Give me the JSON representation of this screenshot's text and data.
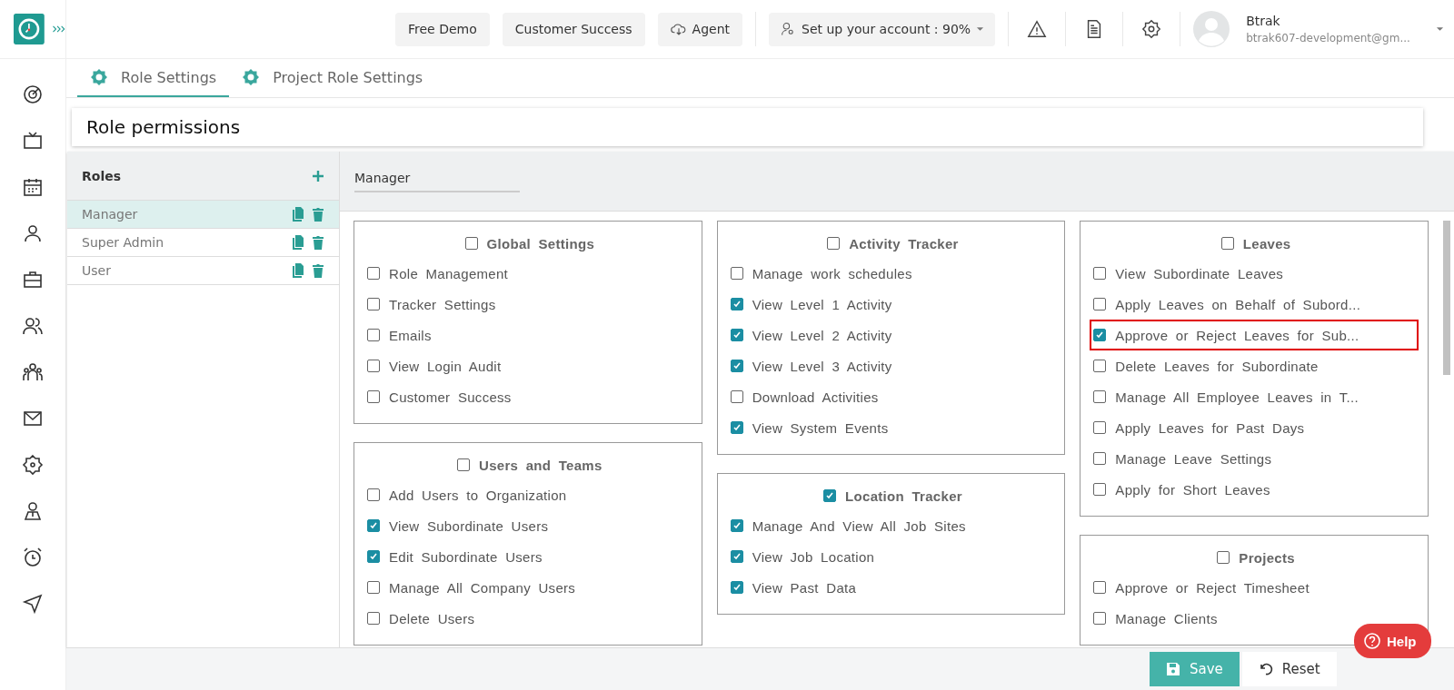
{
  "header": {
    "buttons": [
      {
        "label": "Free Demo",
        "kind": "text"
      },
      {
        "label": "Customer Success",
        "kind": "text"
      },
      {
        "label": "Agent",
        "kind": "cloud"
      }
    ],
    "account_setup": "Set up your account : 90%",
    "user": {
      "name": "Btrak",
      "email": "btrak607-development@gm..."
    }
  },
  "tabs": [
    {
      "label": "Role Settings",
      "selected": true
    },
    {
      "label": "Project Role Settings",
      "selected": false
    }
  ],
  "page_title": "Role permissions",
  "roles": {
    "title": "Roles",
    "items": [
      {
        "name": "Manager",
        "selected": true
      },
      {
        "name": "Super Admin",
        "selected": false
      },
      {
        "name": "User",
        "selected": false
      }
    ]
  },
  "role_name_field": {
    "value": "Manager"
  },
  "columns": [
    [
      {
        "title": "Global Settings",
        "checked": false,
        "permissions": [
          {
            "label": "Role Management",
            "checked": false,
            "highlighted": false
          },
          {
            "label": "Tracker Settings",
            "checked": false,
            "highlighted": false
          },
          {
            "label": "Emails",
            "checked": false,
            "highlighted": false
          },
          {
            "label": "View Login Audit",
            "checked": false,
            "highlighted": false
          },
          {
            "label": "Customer Success",
            "checked": false,
            "highlighted": false
          }
        ]
      },
      {
        "title": "Users and Teams",
        "checked": false,
        "permissions": [
          {
            "label": "Add Users to Organization",
            "checked": false,
            "highlighted": false
          },
          {
            "label": "View Subordinate Users",
            "checked": true,
            "highlighted": false
          },
          {
            "label": "Edit Subordinate Users",
            "checked": true,
            "highlighted": false
          },
          {
            "label": "Manage All Company Users",
            "checked": false,
            "highlighted": false
          },
          {
            "label": "Delete Users",
            "checked": false,
            "highlighted": false
          }
        ]
      }
    ],
    [
      {
        "title": "Activity Tracker",
        "checked": false,
        "permissions": [
          {
            "label": "Manage work schedules",
            "checked": false,
            "highlighted": false
          },
          {
            "label": "View Level 1 Activity",
            "checked": true,
            "highlighted": false
          },
          {
            "label": "View Level 2 Activity",
            "checked": true,
            "highlighted": false
          },
          {
            "label": "View Level 3 Activity",
            "checked": true,
            "highlighted": false
          },
          {
            "label": "Download Activities",
            "checked": false,
            "highlighted": false
          },
          {
            "label": "View System Events",
            "checked": true,
            "highlighted": false
          }
        ]
      },
      {
        "title": "Location Tracker",
        "checked": true,
        "permissions": [
          {
            "label": "Manage And View All Job Sites",
            "checked": true,
            "highlighted": false
          },
          {
            "label": "View Job Location",
            "checked": true,
            "highlighted": false
          },
          {
            "label": "View Past Data",
            "checked": true,
            "highlighted": false
          }
        ]
      }
    ],
    [
      {
        "title": "Leaves",
        "checked": false,
        "permissions": [
          {
            "label": "View Subordinate Leaves",
            "checked": false,
            "highlighted": false
          },
          {
            "label": "Apply Leaves on Behalf of Subord...",
            "checked": false,
            "highlighted": false
          },
          {
            "label": "Approve or Reject Leaves for Sub...",
            "checked": true,
            "highlighted": true
          },
          {
            "label": "Delete Leaves for Subordinate",
            "checked": false,
            "highlighted": false
          },
          {
            "label": "Manage All Employee Leaves in T...",
            "checked": false,
            "highlighted": false
          },
          {
            "label": "Apply Leaves for Past Days",
            "checked": false,
            "highlighted": false
          },
          {
            "label": "Manage Leave Settings",
            "checked": false,
            "highlighted": false
          },
          {
            "label": "Apply for Short Leaves",
            "checked": false,
            "highlighted": false
          }
        ]
      },
      {
        "title": "Projects",
        "checked": false,
        "permissions": [
          {
            "label": "Approve or Reject Timesheet",
            "checked": false,
            "highlighted": false
          },
          {
            "label": "Manage Clients",
            "checked": false,
            "highlighted": false
          }
        ]
      }
    ]
  ],
  "footer": {
    "save": "Save",
    "reset": "Reset"
  },
  "help": "Help"
}
